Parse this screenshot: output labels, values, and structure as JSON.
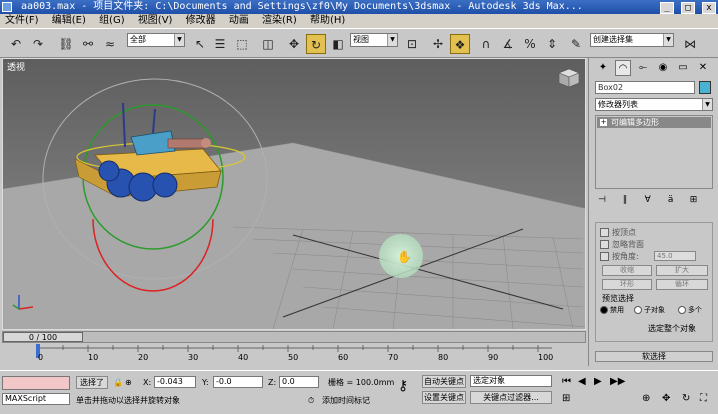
{
  "window": {
    "title": "aa003.max    - 项目文件夹: C:\\Documents and Settings\\zf0\\My Documents\\3dsmax      - Autodesk 3ds Max...",
    "buttons": [
      "_",
      "□",
      "x"
    ]
  },
  "menu": [
    "文件(F)",
    "编辑(E)",
    "组(G)",
    "视图(V)",
    "修改器",
    "动画",
    "渲染(R)",
    "帮助(H)"
  ],
  "toolbar": {
    "selection_filter": "全部",
    "reference_coord": "视图",
    "named_selection": "创建选择集"
  },
  "viewport": {
    "label": "透视"
  },
  "command_panel": {
    "object_name": "Box02",
    "object_color": "#4ab3d1",
    "modifier_list": "修改器列表",
    "stack_item": "可编辑多边形",
    "selection": {
      "by_vertex": "按顶点",
      "ignore_backface": "忽略背面",
      "by_angle": "按角度:",
      "angle_value": "45.0",
      "shrink": "收缩",
      "grow": "扩大",
      "ring": "环形",
      "loop": "循环",
      "preview_title": "预览选择",
      "preview_off": "禁用",
      "preview_subobject": "子对象",
      "preview_multi": "多个",
      "whole_object_selected": "选定整个对象"
    },
    "soft_selection": "软选择"
  },
  "timeline": {
    "slider_label": "0 / 100",
    "ticks": [
      "0",
      "10",
      "20",
      "30",
      "40",
      "50",
      "60",
      "70",
      "80",
      "90",
      "100"
    ]
  },
  "status": {
    "maxscript": "MAXScript",
    "selected_label": "选择了",
    "x_label": "X:",
    "x_value": "-0.043",
    "y_label": "Y:",
    "y_value": "-0.0",
    "z_label": "Z:",
    "z_value": "0.0",
    "grid_label": "栅格 = 100.0mm",
    "auto_key": "自动关键点",
    "selected_object": "选定对象",
    "set_key": "设置关键点",
    "key_filters": "关键点过滤器...",
    "prompt": "单击并拖动以选择并旋转对象",
    "add_time_tag": "添加时间标记"
  }
}
